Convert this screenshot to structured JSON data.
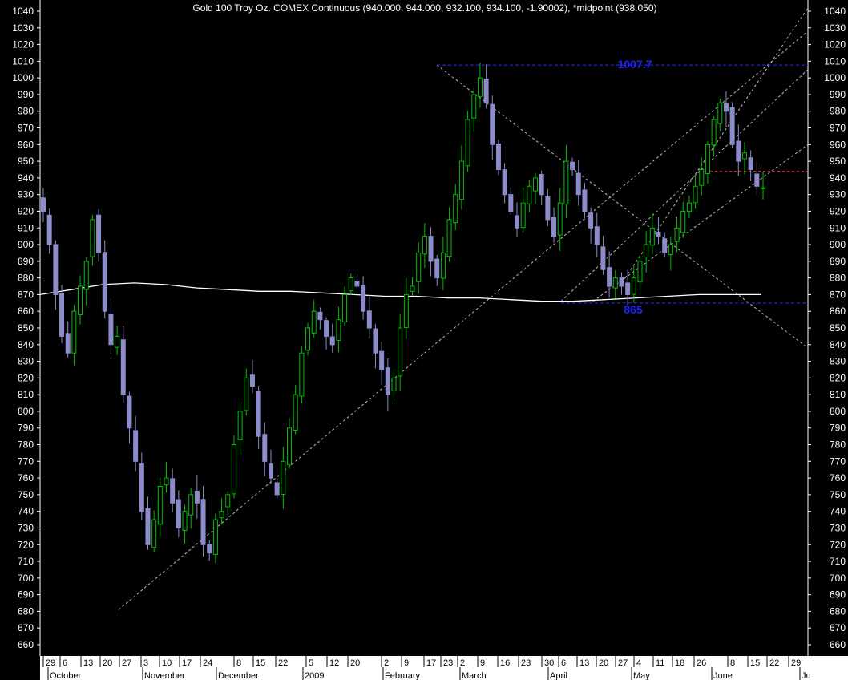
{
  "chart_data": {
    "type": "candlestick",
    "title": "Gold 100 Troy Oz. COMEX Continuous (940.000, 944.000, 932.100, 934.100, -1.90002), *midpoint (938.050)",
    "ylim": [
      656,
      1044
    ],
    "yticks": [
      660,
      670,
      680,
      690,
      700,
      710,
      720,
      730,
      740,
      750,
      760,
      770,
      780,
      790,
      800,
      810,
      820,
      830,
      840,
      850,
      860,
      870,
      880,
      890,
      900,
      910,
      920,
      930,
      940,
      950,
      960,
      970,
      980,
      990,
      1000,
      1010,
      1020,
      1030,
      1040
    ],
    "x_day_labels": [
      "29",
      "6",
      "13",
      "20",
      "27",
      "3",
      "10",
      "17",
      "24",
      "8",
      "15",
      "22",
      "5",
      "12",
      "20",
      "2",
      "9",
      "17",
      "23",
      "2",
      "9",
      "16",
      "23",
      "30",
      "6",
      "13",
      "20",
      "27",
      "4",
      "11",
      "18",
      "26",
      "8",
      "15",
      "22",
      "29"
    ],
    "x_month_labels": [
      "October",
      "November",
      "December",
      "2009",
      "February",
      "March",
      "April",
      "May",
      "June",
      "Ju"
    ],
    "levels": [
      {
        "value": 1007.7,
        "label": "1007.7",
        "color": "#2030ff"
      },
      {
        "value": 865,
        "label": "865",
        "color": "#2030ff"
      },
      {
        "value": 944,
        "label": "",
        "color": "#ff3030"
      }
    ],
    "trendlines": "dashed white/gray channel and trend lines",
    "moving_average": "white smoothed line near 865-878",
    "up_color": "#00c000",
    "down_color": "#8c8ccc",
    "closes": [
      920,
      900,
      870,
      845,
      835,
      860,
      875,
      890,
      915,
      895,
      860,
      840,
      845,
      810,
      790,
      770,
      740,
      720,
      735,
      755,
      760,
      745,
      730,
      740,
      750,
      745,
      720,
      715,
      735,
      740,
      750,
      780,
      800,
      820,
      815,
      785,
      770,
      760,
      750,
      770,
      790,
      810,
      835,
      850,
      860,
      855,
      845,
      840,
      855,
      870,
      880,
      875,
      860,
      850,
      835,
      825,
      810,
      820,
      850,
      870,
      875,
      895,
      905,
      890,
      880,
      895,
      915,
      930,
      950,
      975,
      990,
      1000,
      985,
      960,
      945,
      930,
      920,
      910,
      925,
      935,
      940,
      930,
      915,
      905,
      925,
      950,
      945,
      930,
      920,
      910,
      900,
      885,
      875,
      880,
      875,
      870,
      880,
      890,
      900,
      910,
      905,
      895,
      900,
      910,
      920,
      925,
      935,
      945,
      960,
      975,
      985,
      980,
      960,
      950,
      955,
      945,
      935,
      934.1
    ],
    "ma_values": [
      870,
      873,
      876,
      877,
      876,
      874,
      873,
      872,
      872,
      871,
      870,
      869,
      869,
      868,
      868,
      867,
      866,
      866,
      867,
      868,
      869,
      870,
      870,
      870
    ]
  }
}
